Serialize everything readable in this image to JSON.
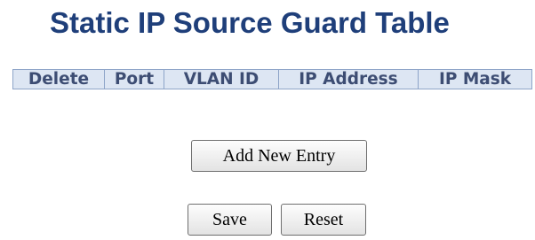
{
  "page": {
    "title": "Static IP Source Guard Table"
  },
  "table": {
    "headers": [
      "Delete",
      "Port",
      "VLAN ID",
      "IP Address",
      "IP Mask"
    ],
    "rows": []
  },
  "buttons": {
    "add_new_entry": "Add New Entry",
    "save": "Save",
    "reset": "Reset"
  },
  "colors": {
    "title": "#1f3f7a",
    "header_background": "#dde6f3",
    "header_text": "#3d4d73",
    "header_border": "#8da4c8"
  }
}
